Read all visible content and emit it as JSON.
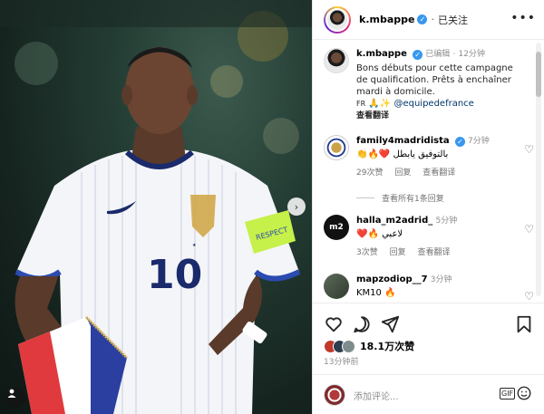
{
  "header": {
    "username": "k.mbappe",
    "follow_state": "已关注"
  },
  "post": {
    "username": "k.mbappe",
    "edited": "已编辑",
    "time": "12分钟",
    "caption_lines": [
      "Bons débuts pour cette campagne",
      "de qualification. Prêts à enchaîner",
      "mardi à domicile."
    ],
    "caption_tail": "FR",
    "caption_emojis": "🙏✨",
    "mention": "@equipedefrance",
    "translate_label": "查看翻译"
  },
  "comments": [
    {
      "username": "family4madridista",
      "time": "7分钟",
      "text": "👏🔥❤️ بالتوفيق يابطل",
      "likes": "29次赞",
      "reply_label": "回复",
      "translate_label": "查看翻译",
      "view_replies": "查看所有1条回复"
    },
    {
      "username": "halla_m2adrid_",
      "time": "5分钟",
      "text": "❤️🔥 لاعبي",
      "likes": "3次赞",
      "reply_label": "回复",
      "translate_label": "查看翻译"
    },
    {
      "username": "mapzodiop__7",
      "time": "3分钟",
      "text": "KM10 🔥"
    }
  ],
  "footer": {
    "likes_count": "18.1万次赞",
    "time_ago": "13分钟前",
    "comment_placeholder": "添加评论...",
    "gif_label": "GIF"
  },
  "photo": {
    "jersey_number": "10",
    "armband_text": "RESPECT"
  },
  "icons": {
    "verified": "verified-badge-icon",
    "more": "more-options-icon",
    "heart": "heart-icon",
    "comment": "comment-icon",
    "share": "share-icon",
    "save": "bookmark-icon",
    "emoji": "emoji-icon",
    "next": "chevron-right-icon",
    "tag": "person-tag-icon"
  },
  "colors": {
    "verified_blue": "#3897f0",
    "mention_blue": "#00376b",
    "jersey_white": "#f4f5f8",
    "jersey_navy": "#1b2a6b",
    "armband_green": "#c6f04a"
  }
}
